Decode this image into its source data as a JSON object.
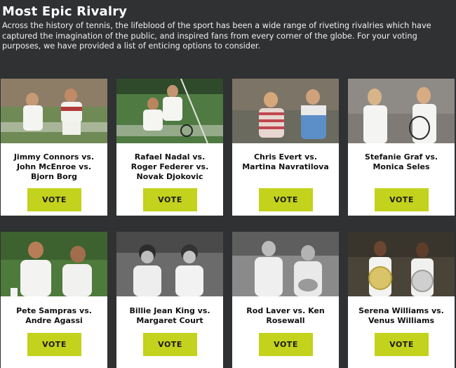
{
  "page": {
    "title": "Most Epic Rivalry",
    "intro": "Across the history of tennis, the lifeblood of the sport has been a wide range of riveting rivalries which have captured the imagination of the public, and inspired fans from every corner of the globe. For your voting purposes, we have provided a list of enticing options to consider."
  },
  "colors": {
    "background": "#2f3133",
    "card": "#ffffff",
    "vote_button": "#c3d21c"
  },
  "cards": [
    {
      "lines": [
        "Jimmy Connors vs.",
        "John McEnroe vs.",
        "Bjorn Borg"
      ],
      "vote_label": "VOTE",
      "photo": "connors-mcenroe-photo"
    },
    {
      "lines": [
        "Rafael Nadal vs.",
        "Roger Federer vs.",
        "Novak Djokovic"
      ],
      "vote_label": "VOTE",
      "photo": "nadal-federer-photo"
    },
    {
      "lines": [
        "Chris Evert vs.",
        "Martina Navratilova"
      ],
      "vote_label": "VOTE",
      "photo": "evert-navratilova-photo"
    },
    {
      "lines": [
        "Stefanie Graf vs.",
        "Monica Seles"
      ],
      "vote_label": "VOTE",
      "photo": "graf-seles-photo"
    },
    {
      "lines": [
        "Pete Sampras vs.",
        "Andre Agassi"
      ],
      "vote_label": "VOTE",
      "photo": "sampras-agassi-photo"
    },
    {
      "lines": [
        "Billie Jean King vs.",
        "Margaret Court"
      ],
      "vote_label": "VOTE",
      "photo": "king-court-photo"
    },
    {
      "lines": [
        "Rod Laver vs. Ken",
        "Rosewall"
      ],
      "vote_label": "VOTE",
      "photo": "laver-rosewall-photo"
    },
    {
      "lines": [
        "Serena Williams vs.",
        "Venus Williams"
      ],
      "vote_label": "VOTE",
      "photo": "williams-sisters-photo"
    }
  ]
}
